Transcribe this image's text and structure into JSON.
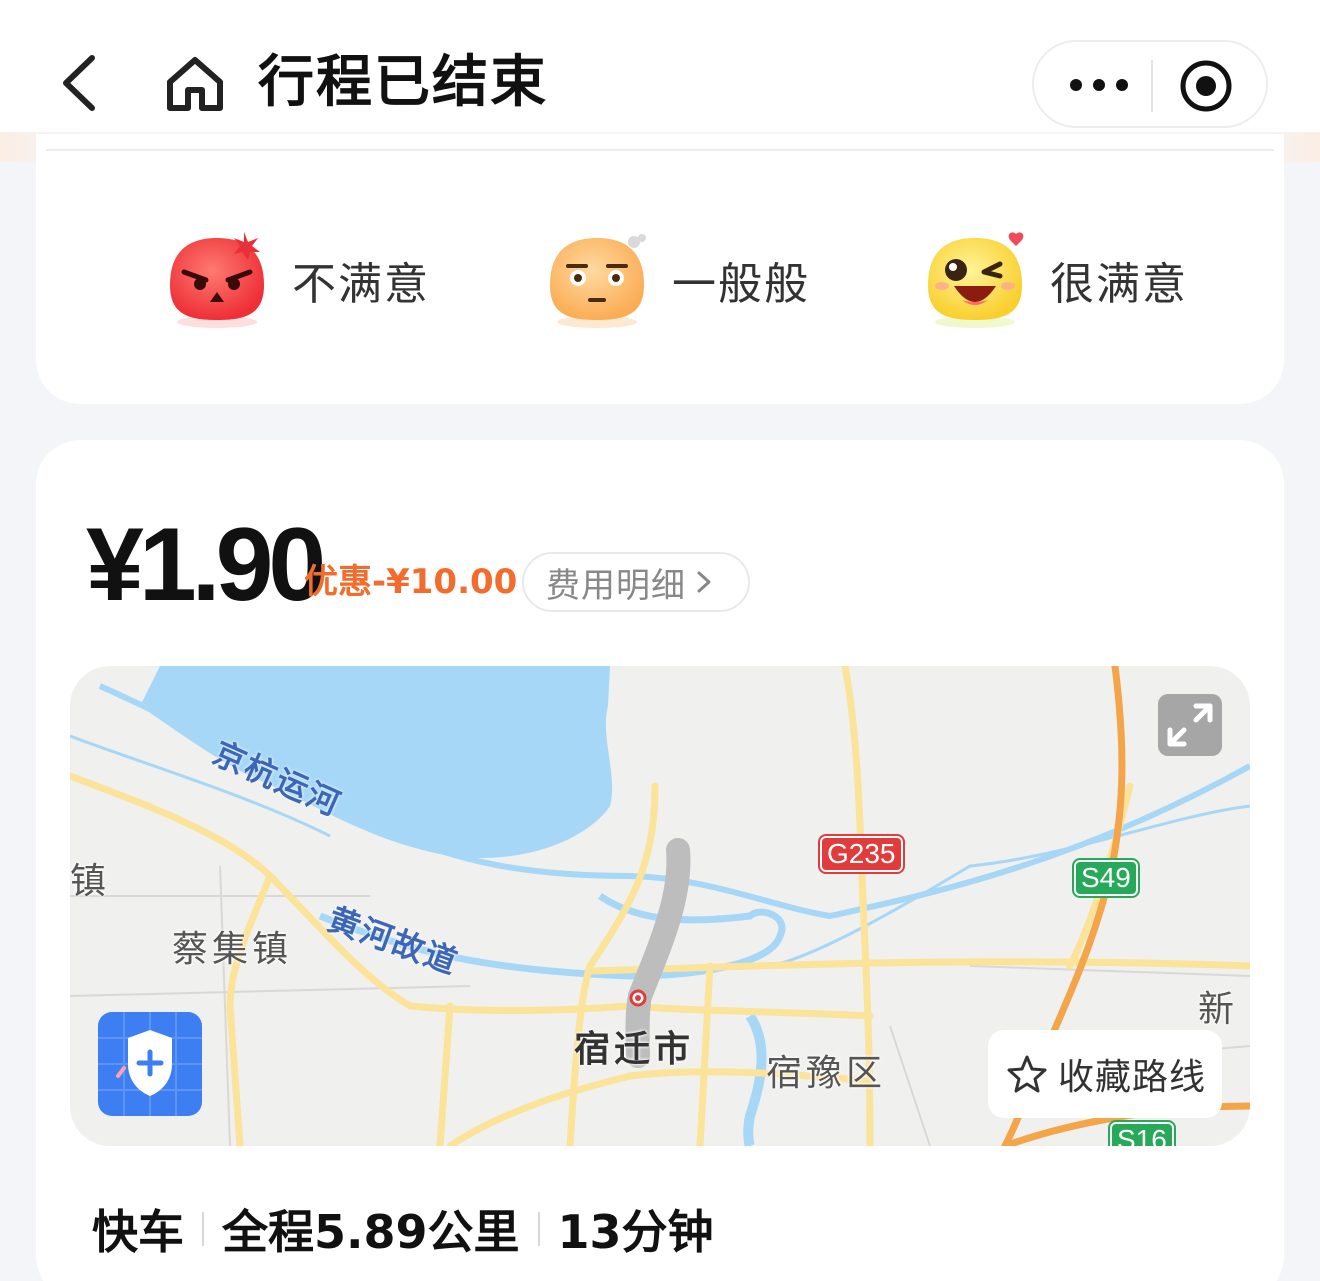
{
  "header": {
    "title": "行程已结束"
  },
  "rating": {
    "options": [
      {
        "label": "不满意",
        "emoji": "angry-face-icon"
      },
      {
        "label": "一般般",
        "emoji": "neutral-face-icon"
      },
      {
        "label": "很满意",
        "emoji": "happy-face-icon"
      }
    ]
  },
  "fare": {
    "price": "¥1.90",
    "discount": "优惠-¥10.00",
    "detail_label": "费用明细"
  },
  "map": {
    "labels": {
      "canal": "京杭运河",
      "old_yellow_river": "黄河故道",
      "cai_ji_town": "蔡集镇",
      "town_edge": "镇",
      "suqian_city": "宿迁市",
      "suyu_district": "宿豫区",
      "xin_edge": "新"
    },
    "roads": {
      "g235": "G235",
      "s49": "S49",
      "s16": "S16"
    },
    "favorite_route_label": "收藏路线"
  },
  "trip": {
    "service": "快车",
    "distance": "全程5.89公里",
    "duration": "13分钟"
  },
  "colors": {
    "accent": "#f26d2d",
    "water": "#a7d7f7",
    "route": "#bdbdbd",
    "safety": "#3d7ef3"
  }
}
